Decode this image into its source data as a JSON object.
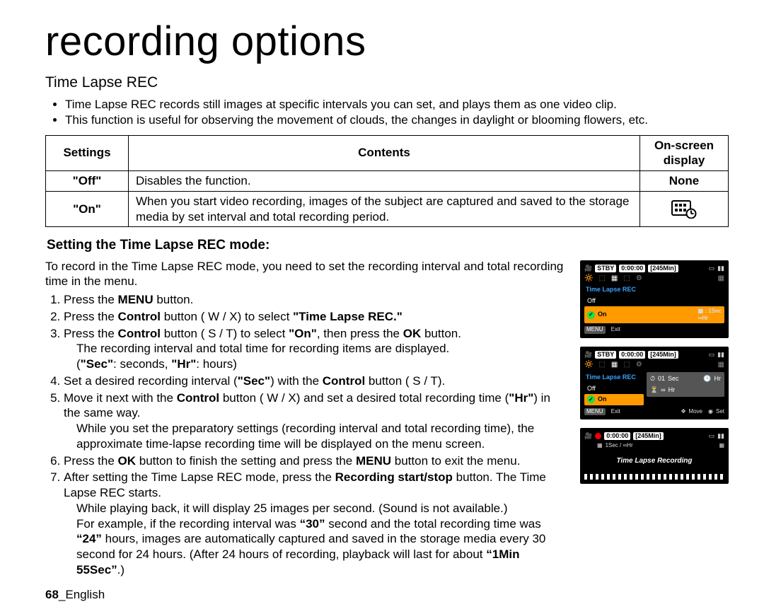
{
  "page_title": "recording options",
  "section": "Time Lapse REC",
  "intro": [
    "Time Lapse REC records still images at specific intervals you can set, and plays them as one video clip.",
    "This function is useful for observing the movement of clouds, the changes in daylight or blooming flowers, etc."
  ],
  "table": {
    "headers": {
      "settings": "Settings",
      "contents": "Contents",
      "onscreen": "On-screen display"
    },
    "rows": [
      {
        "setting": "\"Off\"",
        "content": "Disables the function.",
        "display": "None"
      },
      {
        "setting": "\"On\"",
        "content": "When you start video recording, images of the subject are captured and saved to the storage media by set interval and total recording period.",
        "display_icon": true
      }
    ]
  },
  "sub_heading": "Setting the Time Lapse REC mode:",
  "lead_in": "To record in the Time Lapse REC mode, you need to set the recording interval and total recording time in the menu.",
  "steps": {
    "s1a": "Press the ",
    "s1b": "MENU",
    "s1c": " button.",
    "s2a": "Press the ",
    "s2b": "Control",
    "s2c": " button ( W /  X) to select ",
    "s2d": "\"Time Lapse REC.\"",
    "s3a": "Press the ",
    "s3b": "Control",
    "s3c": " button ( S  /  T) to select ",
    "s3d": "\"On\"",
    "s3e": ", then press the ",
    "s3f": "OK",
    "s3g": " button.",
    "s3sub1": "The recording interval and total time for recording items are displayed.",
    "s3sub2a": "(",
    "s3sub2b": "\"Sec\"",
    "s3sub2c": ": seconds, ",
    "s3sub2d": "\"Hr\"",
    "s3sub2e": ": hours)",
    "s4a": "Set a desired recording interval (",
    "s4b": "\"Sec\"",
    "s4c": ") with the ",
    "s4d": "Control",
    "s4e": " button ( S  /  T).",
    "s5a": "Move it next with the ",
    "s5b": "Control",
    "s5c": " button ( W /  X) and set a desired total recording time (",
    "s5d": "\"Hr\"",
    "s5e": ") in the same way.",
    "s5sub": "While you set the preparatory settings (recording interval and total recording time), the approximate time-lapse recording time will be displayed on the menu screen.",
    "s6a": "Press the ",
    "s6b": "OK",
    "s6c": " button to finish the setting and press the ",
    "s6d": "MENU",
    "s6e": " button to exit the menu.",
    "s7a": "After setting the Time Lapse REC mode, press the ",
    "s7b": "Recording start/stop",
    "s7c": " button. The Time Lapse REC starts.",
    "s7sub1": "While playing back, it will display 25 images per second. (Sound is not available.)",
    "s7sub2a": "For example, if the recording interval was ",
    "s7sub2b": "“30”",
    "s7sub2c": " second and the total recording time was ",
    "s7sub2d": "“24”",
    "s7sub2e": " hours, images are automatically captured and saved in the storage media every 30 second for 24 hours. (After 24 hours of recording, playback will last for about ",
    "s7sub2f": "“1Min 55Sec”",
    "s7sub2g": ".)"
  },
  "screens": {
    "a": {
      "status": "STBY",
      "time": "0:00:00",
      "remain": "[245Min]",
      "title": "Time Lapse REC",
      "off": "Off",
      "on": "On",
      "right1": ": 1Sec",
      "right2": "∞Hr",
      "exit": "Exit"
    },
    "b": {
      "status": "STBY",
      "time": "0:00:00",
      "remain": "[245Min]",
      "title": "Time Lapse REC",
      "on": "On",
      "box_sec": "01",
      "box_sec_lbl": "Sec",
      "box_hr_lbl": "Hr",
      "box_inf": "∞",
      "box_inf_lbl": "Hr",
      "exit": "Exit",
      "move": "Move",
      "set": "Set"
    },
    "c": {
      "time": "0:00:00",
      "remain": "[245Min]",
      "info": "1Sec / ∞Hr",
      "label": "Time Lapse Recording"
    }
  },
  "footer": {
    "page": "68",
    "sep": "_",
    "lang": "English"
  }
}
